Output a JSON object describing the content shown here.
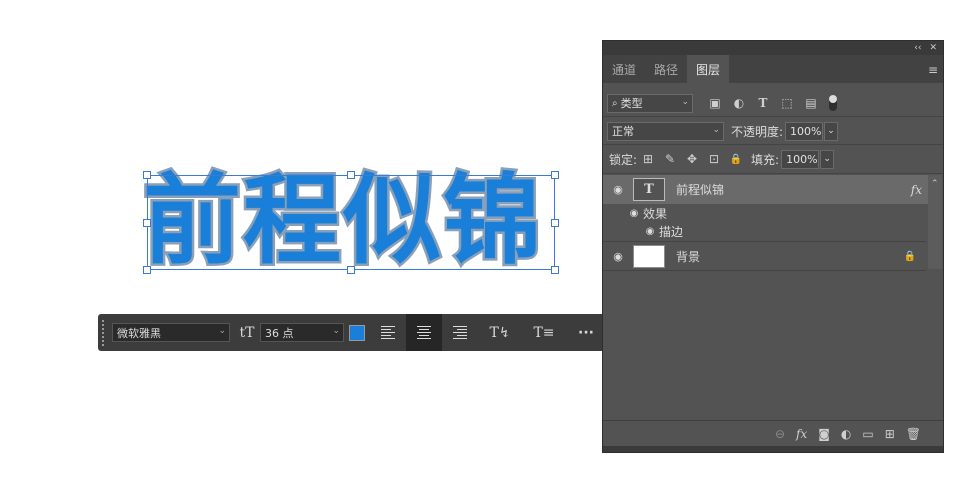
{
  "canvas": {
    "text_layer_content": "前程似锦",
    "text_fill_color": "#1a7fd9",
    "text_stroke_color": "#8aa0b8"
  },
  "taskbar": {
    "font_family_value": "微软雅黑",
    "font_size_icon": "tT",
    "font_size_value": "36 点",
    "color_swatch": "#1a7fd9",
    "align_left_icon": "align-left-icon",
    "align_center_icon": "align-center-icon",
    "align_right_icon": "align-right-icon",
    "warp_text_icon": "T↯",
    "char_panel_icon": "T≡",
    "more_icon": "···"
  },
  "panel": {
    "collapse_icon": "‹‹",
    "close_icon": "✕",
    "tabs": [
      "通道",
      "路径",
      "图层"
    ],
    "active_tab": "图层",
    "menu_icon": "≡",
    "filter": {
      "search_icon": "🔍",
      "kind_value": "类型"
    },
    "filter_icons": [
      "▣",
      "◐",
      "T",
      "⬚",
      "▤"
    ],
    "blend_mode": "正常",
    "opacity_label": "不透明度:",
    "opacity_value": "100%",
    "lock_label": "锁定:",
    "lock_icons": [
      "⊞",
      "✎",
      "✥",
      "⊡",
      "🔒"
    ],
    "fill_label": "填充:",
    "fill_value": "100%",
    "layers": [
      {
        "name": "前程似锦",
        "type": "text",
        "fx": "fx",
        "selected": true
      },
      {
        "name": "效果",
        "type": "effects-group"
      },
      {
        "name": "描边",
        "type": "effect"
      },
      {
        "name": "背景",
        "type": "background",
        "locked": true
      }
    ],
    "bottom_icons": [
      "⊖",
      "fx",
      "◙",
      "◐",
      "▭",
      "⊞",
      "🗑"
    ]
  }
}
